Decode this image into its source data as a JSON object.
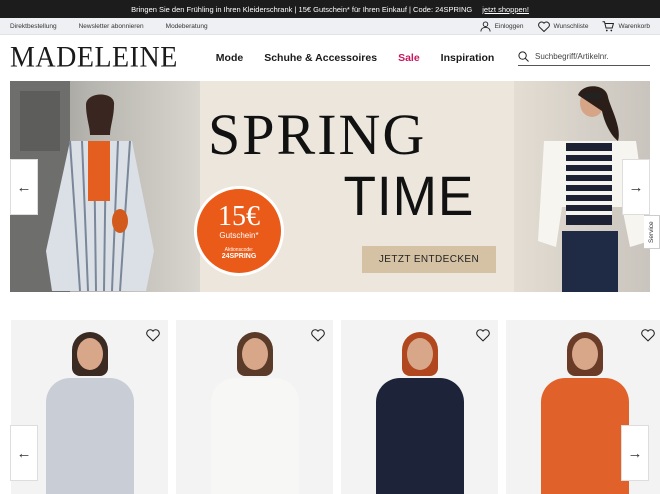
{
  "promo": {
    "text": "Bringen Sie den Frühling in Ihren Kleiderschrank | 15€ Gutschein* für Ihren Einkauf | Code: 24SPRING",
    "link": "jetzt shoppen!"
  },
  "utility": {
    "left": [
      "Direktbestellung",
      "Newsletter abonnieren",
      "Modeberatung"
    ],
    "login": "Einloggen",
    "wishlist": "Wunschliste",
    "cart": "Warenkorb"
  },
  "header": {
    "logo": "MADELEINE",
    "nav": [
      "Mode",
      "Schuhe & Accessoires",
      "Sale",
      "Inspiration"
    ],
    "search_placeholder": "Suchbegriff/Artikelnr."
  },
  "hero": {
    "title_line1": "SPRING",
    "title_line2": "TIME",
    "badge_amount": "15€",
    "badge_label": "Gutschein*",
    "badge_code_label": "Aktionscode:",
    "badge_code": "24SPRING",
    "cta": "JETZT ENTDECKEN"
  },
  "service_tab": "Service",
  "colors": {
    "promo_bg": "#1c1c1c",
    "sale": "#c8175d",
    "badge": "#ea5a18",
    "cta_bg": "#d5c2a4"
  },
  "products": [
    {
      "name": "striped-trench-coat",
      "hair": "#3a2a22",
      "body": "#c9ced6"
    },
    {
      "name": "white-top",
      "hair": "#5a3a28",
      "body": "#f7f7f5"
    },
    {
      "name": "striped-sweater",
      "hair": "#b0471f",
      "body": "#1d2338"
    },
    {
      "name": "orange-coat",
      "hair": "#6a3c28",
      "body": "#e0622a"
    }
  ]
}
